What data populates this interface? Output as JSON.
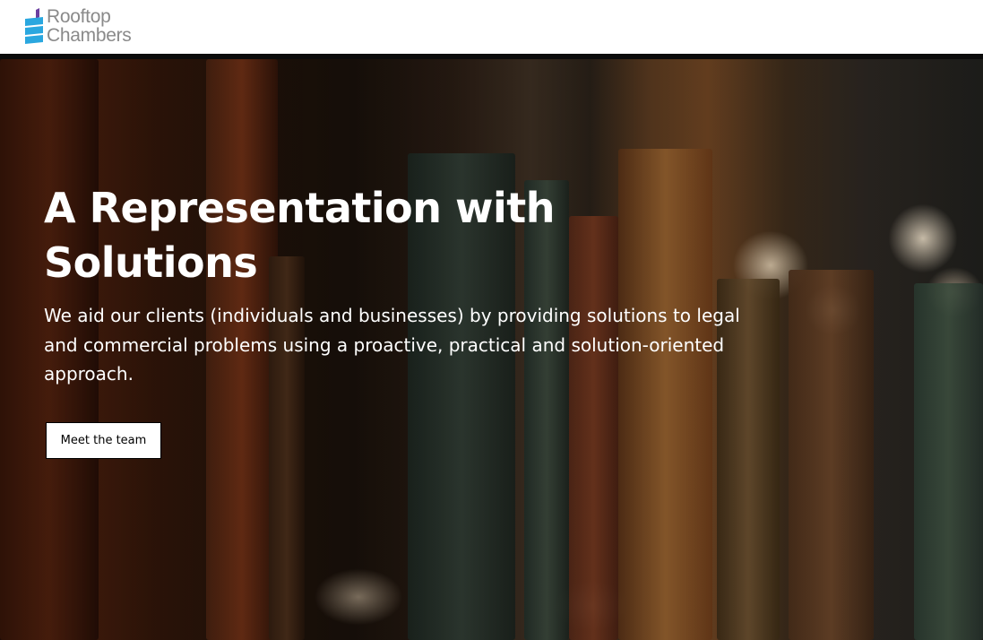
{
  "brand": {
    "logo_line1": "Rooftop",
    "logo_line2": "Chambers",
    "colors": {
      "logo_blue": "#2aa7df",
      "logo_purple": "#6b3fa0",
      "logo_text": "#8a8a8a"
    }
  },
  "hero": {
    "title": "A Representation with Solutions",
    "description": "We aid our clients (individuals and businesses) by providing solutions to legal and commercial problems using a proactive, practical and solution-oriented approach.",
    "cta_label": "Meet the team",
    "background_image": "bookshelf-with-old-books-icon"
  }
}
